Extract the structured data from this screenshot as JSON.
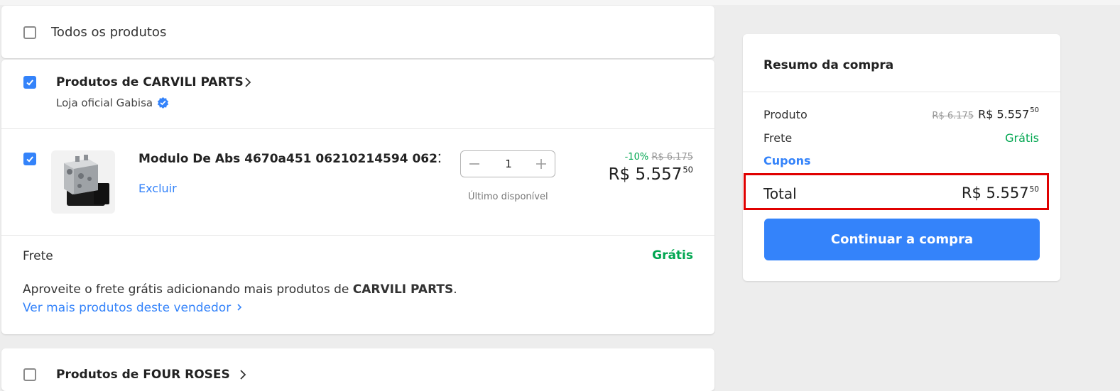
{
  "all_products": {
    "label": "Todos os produtos",
    "checked": false
  },
  "seller1": {
    "title": "Produtos de CARVILI PARTS",
    "subtitle": "Loja oficial Gabisa",
    "checked": true,
    "item": {
      "title": "Modulo De Abs 4670a451 06210214594 0621...",
      "delete_label": "Excluir",
      "quantity": "1",
      "availability": "Último disponível",
      "discount": "-10%",
      "old_price": "R$ 6.175",
      "price_main": "R$ 5.557",
      "price_cents": "50",
      "checked": true
    },
    "shipping_label": "Frete",
    "shipping_value": "Grátis",
    "promo_text": "Aproveite o frete grátis adicionando mais produtos de",
    "promo_seller": "CARVILI PARTS",
    "promo_period": ".",
    "promo_link": "Ver mais produtos deste vendedor"
  },
  "seller2": {
    "title": "Produtos de FOUR  ROSES",
    "checked": false
  },
  "summary": {
    "title": "Resumo da compra",
    "product_label": "Produto",
    "product_old_price": "R$ 6.175",
    "product_price_main": "R$ 5.557",
    "product_price_cents": "50",
    "shipping_label": "Frete",
    "shipping_value": "Grátis",
    "coupons_label": "Cupons",
    "total_label": "Total",
    "total_main": "R$ 5.557",
    "total_cents": "50",
    "continue_button": "Continuar a compra"
  },
  "colors": {
    "accent": "#3483fa",
    "success": "#00a650",
    "highlight": "#e00000"
  }
}
